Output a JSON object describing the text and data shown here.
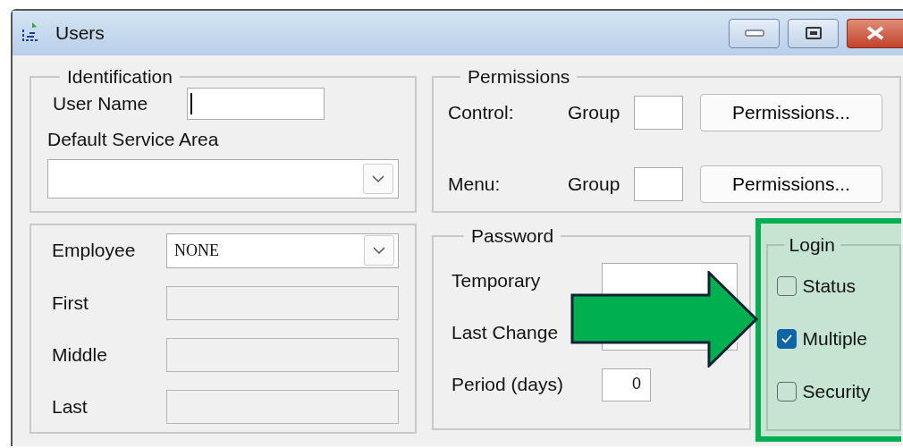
{
  "window": {
    "title": "Users"
  },
  "identification": {
    "title": "Identification",
    "user_name_label": "User Name",
    "service_area_label": "Default Service Area"
  },
  "permissions": {
    "title": "Permissions",
    "rows": [
      {
        "label": "Control:",
        "group_label": "Group",
        "button": "Permissions..."
      },
      {
        "label": "Menu:",
        "group_label": "Group",
        "button": "Permissions..."
      }
    ]
  },
  "employee": {
    "label": "Employee",
    "value": "NONE",
    "fields": [
      {
        "label": "First"
      },
      {
        "label": "Middle"
      },
      {
        "label": "Last"
      }
    ]
  },
  "password": {
    "title": "Password",
    "fields": [
      {
        "label": "Temporary"
      },
      {
        "label": "Last Change"
      },
      {
        "label": "Period (days)",
        "value": "0"
      }
    ]
  },
  "login": {
    "title": "Login",
    "highlighted": true,
    "options": [
      {
        "label": "Status",
        "checked": false
      },
      {
        "label": "Multiple",
        "checked": true
      },
      {
        "label": "Security",
        "checked": false
      }
    ]
  }
}
